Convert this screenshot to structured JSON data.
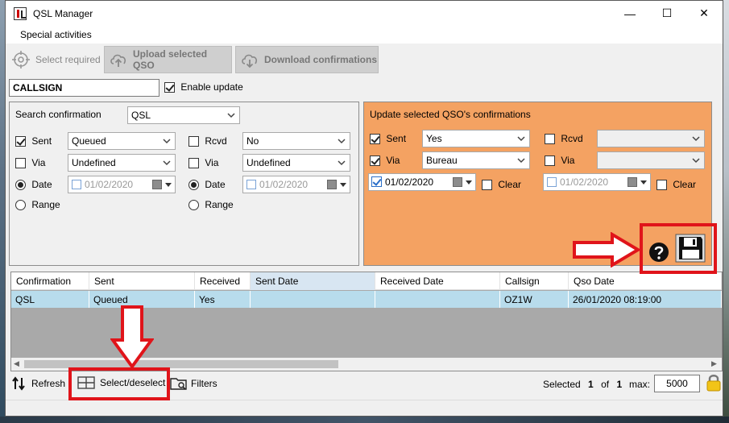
{
  "window": {
    "title": "QSL Manager",
    "controls": {
      "minimize": "—",
      "maximize": "☐",
      "close": "✕"
    }
  },
  "menu": {
    "special_activities": "Special activities"
  },
  "toolbar": {
    "select_required": "Select required",
    "upload": "Upload selected QSO",
    "download": "Download confirmations"
  },
  "callsign": {
    "value": "CALLSIGN"
  },
  "enable_update": {
    "label": "Enable update",
    "checked": true
  },
  "search": {
    "label": "Search confirmation",
    "type": "QSL",
    "sent": {
      "label": "Sent",
      "checked": true,
      "value": "Queued"
    },
    "sent_via": {
      "label": "Via",
      "checked": false,
      "value": "Undefined"
    },
    "sent_date": {
      "label": "Date",
      "selected": true,
      "value": "01/02/2020"
    },
    "sent_range": {
      "label": "Range"
    },
    "rcvd": {
      "label": "Rcvd",
      "checked": false,
      "value": "No"
    },
    "rcvd_via": {
      "label": "Via",
      "checked": false,
      "value": "Undefined"
    },
    "rcvd_date": {
      "label": "Date",
      "selected": true,
      "value": "01/02/2020"
    },
    "rcvd_range": {
      "label": "Range"
    }
  },
  "update": {
    "title": "Update selected QSO's confirmations",
    "sent": {
      "label": "Sent",
      "checked": true,
      "value": "Yes"
    },
    "via": {
      "label": "Via",
      "checked": true,
      "value": "Bureau"
    },
    "sent_date": {
      "value": "01/02/2020",
      "clear_label": "Clear"
    },
    "rcvd": {
      "label": "Rcvd",
      "checked": false,
      "value": ""
    },
    "rcvd_via": {
      "label": "Via",
      "checked": false,
      "value": ""
    },
    "rcvd_date": {
      "value": "01/02/2020",
      "clear_label": "Clear"
    },
    "bg_color": "#f4a262"
  },
  "table": {
    "columns": [
      "Confirmation",
      "Sent",
      "Received",
      "Sent Date",
      "Received Date",
      "Callsign",
      "Qso Date"
    ],
    "rows": [
      {
        "confirmation": "QSL",
        "sent": "Queued",
        "received": "Yes",
        "sent_date": "",
        "received_date": "",
        "callsign": "OZ1W",
        "qso_date": "26/01/2020 08:19:00"
      }
    ]
  },
  "status": {
    "refresh": "Refresh",
    "select_deselect": "Select/deselect",
    "filters": "Filters",
    "selected_label": "Selected",
    "selected_count": "1",
    "of_label": "of",
    "total": "1",
    "max_label": "max:",
    "max_value": "5000"
  },
  "annotations": {
    "highlight_color": "#e0141a"
  }
}
